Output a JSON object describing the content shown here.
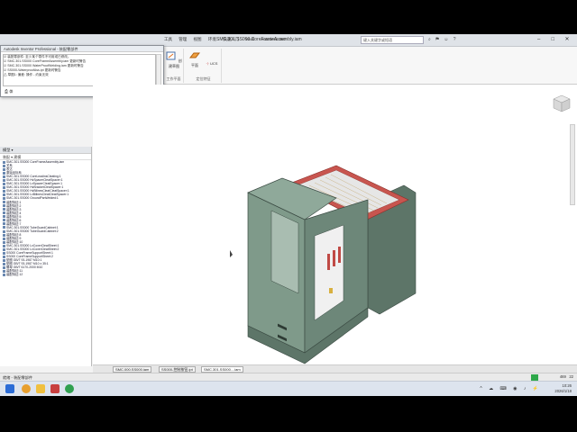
{
  "window": {
    "title": "SMC.301.SS000 CoreFrameAssembly.iam",
    "search_placeholder": "键入关键字或短语",
    "menu_tabs": [
      "工具",
      "管理",
      "视图",
      "环境",
      "快速入门",
      "Vault",
      "Autodesk 360"
    ]
  },
  "ribbon": {
    "groups": [
      {
        "label": "工作平面",
        "buttons": [
          "创建草图"
        ]
      },
      {
        "label": "定位特征",
        "buttons": [
          "平面",
          "UCS"
        ]
      }
    ]
  },
  "dialog": {
    "title": "Autodesk Inventor Professional - 装配零部件",
    "lines": [
      "☑ 装配零部件: 至少某个零件不可用或已修改。",
      "  ☑ SMC.301.SS000 CoreFrameAssembly.iam  更新时警告",
      "    ☑ SMC.301.SS000 WaterProofWelding.iam  更新时警告",
      "      ☑ SS000-WaterproofAss.ipt  更新时警告",
      "        ⚠ 草图1: 偏差: 操作 - 约束无效"
    ],
    "buttons": {
      "ok": "确定",
      "cancel": "取消"
    }
  },
  "browser": {
    "header": "模型 ▾",
    "tabs": "装配 ▾  建模",
    "items": [
      "SMC.301.SS000 CoreFrameAssembly.iam",
      "关系",
      "表达",
      "原始坐标系",
      "SMC.301.SS000 CoreLeadinsCleating:1",
      "SMC.301.SS000 HvSpacerCleatSpacer:1",
      "SMC.301.SS000 LvSpacerCleatSpacer:1",
      "SMC.301.SS000 HvBracketCleatSpacer:1",
      "SMC.301.SS000 HvBilinesCleatCleatSpacer:1",
      "SMC.301.SS000 LvBilinesCleatCleatSpacer:1",
      "SMC.301.SS000 GroundPanWelded:1",
      "装配特征:1",
      "装配特征:2",
      "装配特征:3",
      "装配特征:4",
      "装配特征:5",
      "装配特征:6",
      "装配特征:7",
      "SMC.301.SS000 TubeGuardCabinet:1",
      "SMC.301.SS000 TubeGuardCabinet:2",
      "装配特征:8",
      "装配特征:9",
      "装配特征:10",
      "SMC.301.SS000 LvCoverCleatSheet:1",
      "SMC.301.SS000 LvCoverCleatSheet:2",
      "SS000 CoreFrameSupportSheet:1",
      "SS000 CoreFrameSupportSheet:2",
      "垫圈 GB/T 93-1987 M10:1",
      "垫圈 GB/T 93-1987 M10 x 35:1",
      "螺母 GB/T 6170-2000 M10",
      "装配特征:11",
      "装配特征:12"
    ]
  },
  "doc_tabs": [
    "SMC.000.SS000.iam",
    "SS000-控制按钮.ipt",
    "SMC.301.SS000....iam"
  ],
  "status": {
    "left": "就绪 - 装配零部件",
    "right_a": "469",
    "right_b": "22"
  },
  "taskbar": {
    "time": "10:26",
    "date": "2026/1/18"
  },
  "colors": {
    "cabinet": "#7f9a8a",
    "cabinet_dark": "#5d7568",
    "frame_red": "#c8554f",
    "ribbon_bg": "#f7f7f7"
  }
}
